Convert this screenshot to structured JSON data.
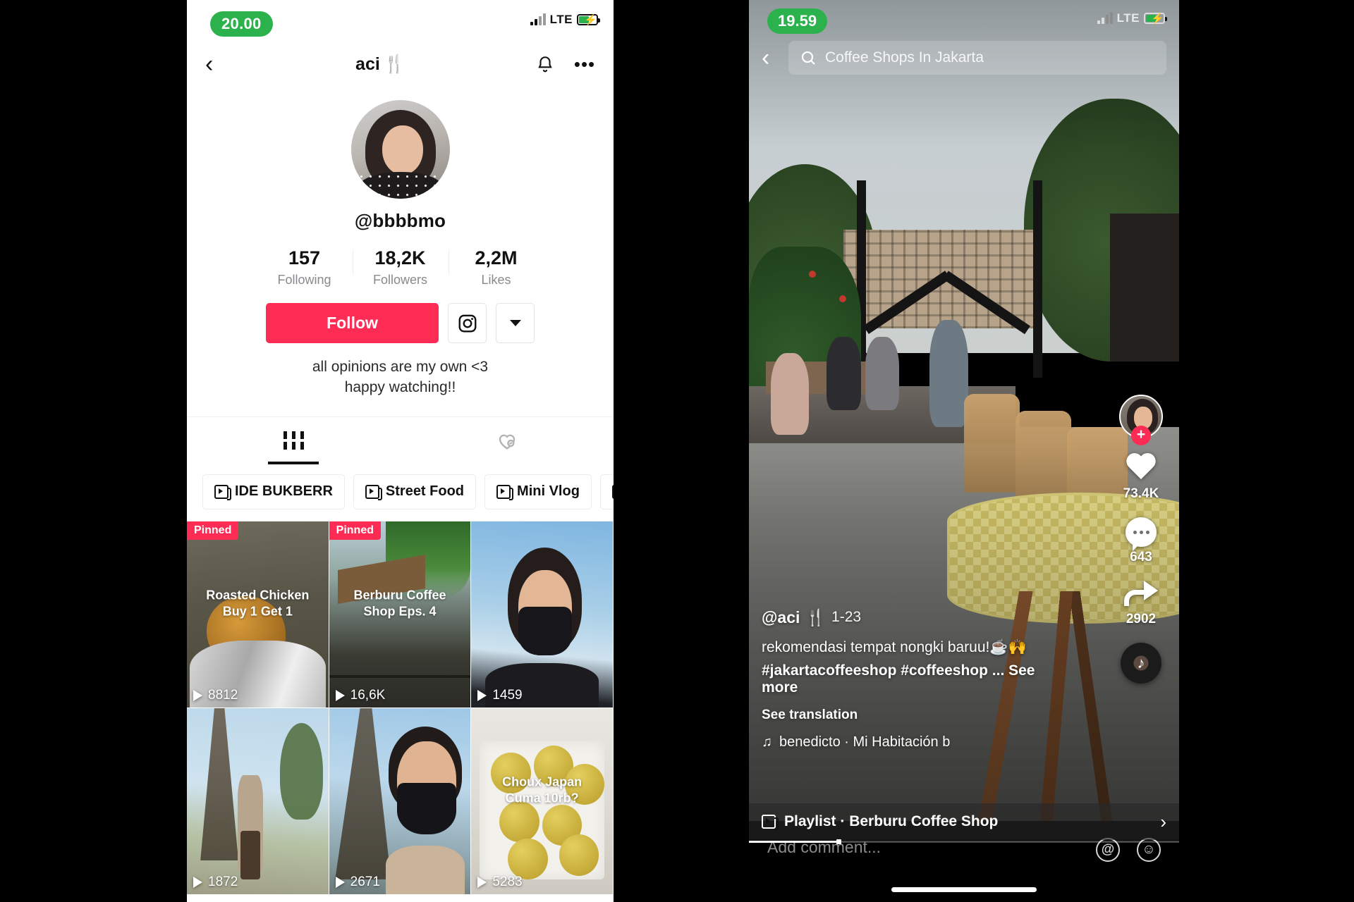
{
  "left_phone": {
    "status": {
      "time": "20.00",
      "network": "LTE",
      "signal_icon": "signal-bars-icon",
      "battery_icon": "battery-charging-icon"
    },
    "header": {
      "back_icon": "back-chevron-icon",
      "title": "aci",
      "title_emoji": "🍴",
      "bell_icon": "bell-icon",
      "more_icon": "more-dots-icon"
    },
    "profile": {
      "avatar_name": "profile-avatar",
      "handle": "@bbbbmo",
      "stats": [
        {
          "num": "157",
          "label": "Following"
        },
        {
          "num": "18,2K",
          "label": "Followers"
        },
        {
          "num": "2,2M",
          "label": "Likes"
        }
      ],
      "follow_label": "Follow",
      "instagram_icon": "instagram-icon",
      "dropdown_icon": "chevron-down-icon",
      "bio_line1": "all opinions are my own <3",
      "bio_line2": "happy watching!!"
    },
    "tabs": [
      {
        "name": "videos-grid-tab",
        "icon": "grid-icon",
        "active": true
      },
      {
        "name": "liked-tab",
        "icon": "heart-lock-icon",
        "active": false
      }
    ],
    "playlists": [
      {
        "label": "IDE BUKBERR"
      },
      {
        "label": "Street Food"
      },
      {
        "label": "Mini Vlog"
      },
      {
        "label": ""
      }
    ],
    "videos": [
      {
        "title": "Roasted Chicken\nBuy 1 Get 1",
        "plays": "8812",
        "pinned": "Pinned",
        "thumb": "th1"
      },
      {
        "title": "Berburu Coffee\nShop Eps. 4",
        "plays": "16,6K",
        "pinned": "Pinned",
        "thumb": "th2"
      },
      {
        "title": "",
        "plays": "1459",
        "pinned": "",
        "thumb": "th3"
      },
      {
        "title": "",
        "plays": "1872",
        "pinned": "",
        "thumb": "th4"
      },
      {
        "title": "",
        "plays": "2671",
        "pinned": "",
        "thumb": "th5"
      },
      {
        "title": "Choux Japan\nCuma 10rb?",
        "plays": "5283",
        "pinned": "",
        "thumb": "th6"
      }
    ]
  },
  "right_phone": {
    "status": {
      "time": "19.59",
      "network": "LTE",
      "signal_icon": "signal-bars-icon",
      "battery_icon": "battery-charging-icon"
    },
    "search": {
      "back_icon": "back-chevron-icon",
      "search_icon": "search-icon",
      "query": "Coffee Shops In Jakarta"
    },
    "rail": {
      "avatar_name": "creator-avatar",
      "follow_plus": "+",
      "like_count": "73.4K",
      "comment_count": "643",
      "share_count": "2902",
      "disc_icon": "music-disc-icon"
    },
    "caption": {
      "username": "@aci",
      "username_emoji": "🍴",
      "date": "1-23",
      "text": "rekomendasi tempat nongki baruu!☕🙌",
      "tags": "#jakartacoffeeshop #coffeeshop ...",
      "see_more": "See more",
      "see_translation": "See translation",
      "music_icon": "music-note-icon",
      "music": "benedicto · Mi Habitación b"
    },
    "playlist_bar": {
      "icon": "playlist-icon",
      "label": "Playlist · Berburu Coffee Shop",
      "chevron": "›"
    },
    "comment_bar": {
      "placeholder": "Add comment...",
      "mention_icon": "@",
      "emoji_icon": "☺"
    }
  },
  "colors": {
    "accent_pink": "#FE2C55",
    "status_green": "#2BB24C"
  }
}
